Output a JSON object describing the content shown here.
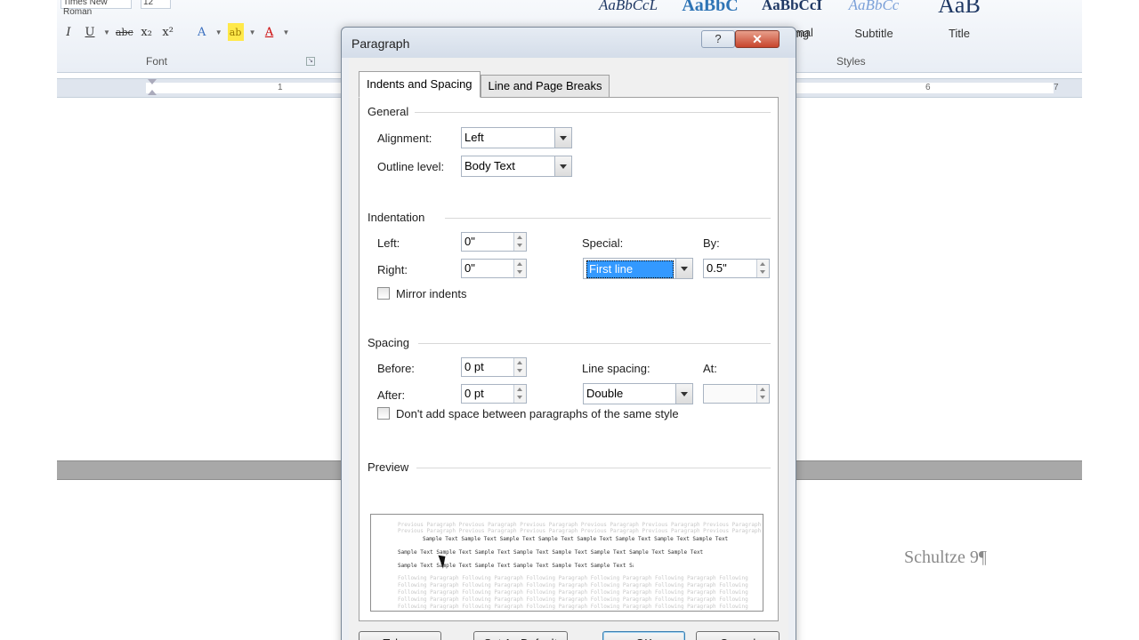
{
  "ribbon": {
    "font_name": "Times New Roman",
    "font_size": "12",
    "font_group_label": "Font",
    "styles_group_label": "Styles",
    "format_buttons": [
      "I",
      "U",
      "abc",
      "x₂",
      "x²",
      "A",
      "ab",
      "A"
    ],
    "styles": [
      {
        "sample": "AaBbCcL",
        "name": ""
      },
      {
        "sample": "AaBbC",
        "name": ""
      },
      {
        "sample": "AaBbCcI",
        "name": "Strong"
      },
      {
        "sample": "AaBbCc",
        "name": "Subtitle"
      },
      {
        "sample": "AaB",
        "name": "Title"
      }
    ],
    "partial_style_name": "mal"
  },
  "ruler": {
    "numbers": [
      "1",
      "6",
      "7"
    ]
  },
  "document": {
    "header_text": "Schultze 9¶"
  },
  "dialog": {
    "title": "Paragraph",
    "help_label": "?",
    "close_label": "✕",
    "tabs": [
      {
        "label": "Indents and Spacing",
        "active": true
      },
      {
        "label": "Line and Page Breaks",
        "active": false
      }
    ],
    "general": {
      "section_title": "General",
      "alignment_label": "Alignment:",
      "alignment_value": "Left",
      "outline_label": "Outline level:",
      "outline_value": "Body Text"
    },
    "indentation": {
      "section_title": "Indentation",
      "left_label": "Left:",
      "left_value": "0\"",
      "right_label": "Right:",
      "right_value": "0\"",
      "special_label": "Special:",
      "special_value": "First line",
      "by_label": "By:",
      "by_value": "0.5\"",
      "mirror_label": "Mirror indents",
      "mirror_checked": false
    },
    "spacing": {
      "section_title": "Spacing",
      "before_label": "Before:",
      "before_value": "0 pt",
      "after_label": "After:",
      "after_value": "0 pt",
      "line_spacing_label": "Line spacing:",
      "line_spacing_value": "Double",
      "at_label": "At:",
      "at_value": "",
      "dont_add_label": "Don't add space between paragraphs of the same style",
      "dont_add_checked": false
    },
    "preview": {
      "section_title": "Preview",
      "previous_paragraph_text": "Previous Paragraph Previous Paragraph Previous Paragraph Previous Paragraph Previous Paragraph Previous Paragraph",
      "sample_text": "Sample Text Sample Text Sample Text Sample Text Sample Text Sample Text Sample Text Sample Text",
      "following_paragraph_text": "Following Paragraph Following Paragraph Following Paragraph Following Paragraph Following Paragraph Following"
    },
    "buttons": {
      "tabs": "Tabs...",
      "set_default": "Set As Default",
      "ok": "OK",
      "cancel": "Cancel"
    }
  }
}
